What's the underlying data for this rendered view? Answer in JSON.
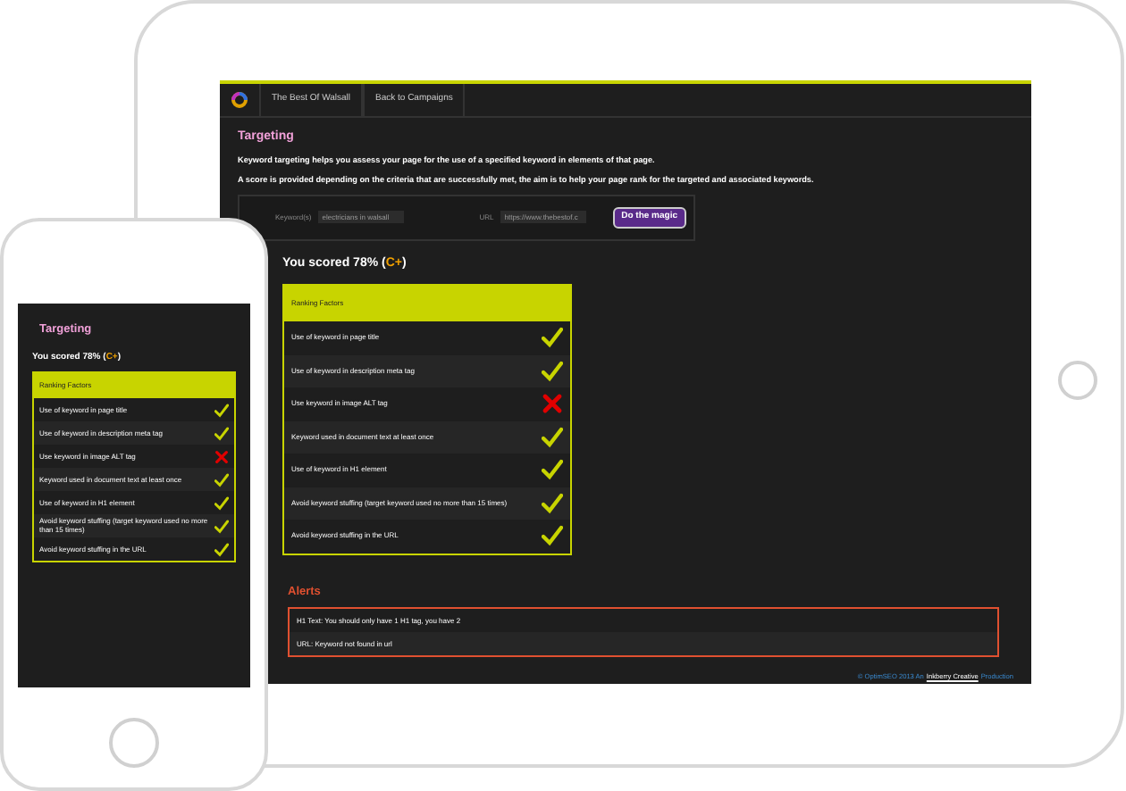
{
  "tablet": {
    "nav": [
      {
        "label": "The Best Of Walsall"
      },
      {
        "label": "Back to Campaigns"
      }
    ],
    "heading": "Targeting",
    "intro": [
      "Keyword targeting helps you assess your page for the use of a specified keyword in elements of that page.",
      "A score is provided depending on the criteria that are successfully met, the aim is to help your page rank for the targeted and associated keywords."
    ],
    "form": {
      "keyword_label": "Keyword(s)",
      "keyword_value": "electricians in walsall",
      "url_label": "URL",
      "url_value": "https://www.thebestof.c",
      "button": "Do the magic"
    },
    "score": {
      "prefix": "You scored 78% (",
      "grade": "C+",
      "suffix": ")"
    },
    "table": {
      "header": "Ranking Factors",
      "rows": [
        {
          "label": "Use of keyword in page title",
          "passed": true
        },
        {
          "label": "Use of keyword in description meta tag",
          "passed": true
        },
        {
          "label": "Use keyword in image ALT tag",
          "passed": false
        },
        {
          "label": "Keyword used in document text at least once",
          "passed": true
        },
        {
          "label": "Use of keyword in H1 element",
          "passed": true
        },
        {
          "label": "Avoid keyword stuffing (target keyword used no more than 15 times)",
          "passed": true
        },
        {
          "label": "Avoid keyword stuffing in the URL",
          "passed": true
        }
      ]
    },
    "alerts": {
      "heading": "Alerts",
      "items": [
        "H1 Text: You should only have 1 H1 tag, you have 2",
        "URL: Keyword not found in url"
      ]
    },
    "footer": {
      "prefix": "© OptimSEO 2013 An",
      "link": "Inkberry Creative",
      "suffix": "Production"
    }
  },
  "phone": {
    "heading": "Targeting",
    "score": {
      "prefix": "You scored 78% (",
      "grade": "C+",
      "suffix": ")"
    },
    "table": {
      "header": "Ranking Factors",
      "rows": [
        {
          "label": "Use of keyword in page title",
          "passed": true
        },
        {
          "label": "Use of keyword in description meta tag",
          "passed": true
        },
        {
          "label": "Use keyword in image ALT tag",
          "passed": false
        },
        {
          "label": "Keyword used in document text at least once",
          "passed": true
        },
        {
          "label": "Use of keyword in H1 element",
          "passed": true
        },
        {
          "label": "Avoid keyword stuffing (target keyword used no more than 15 times)",
          "passed": true
        },
        {
          "label": "Avoid keyword stuffing in the URL",
          "passed": true
        }
      ]
    }
  }
}
